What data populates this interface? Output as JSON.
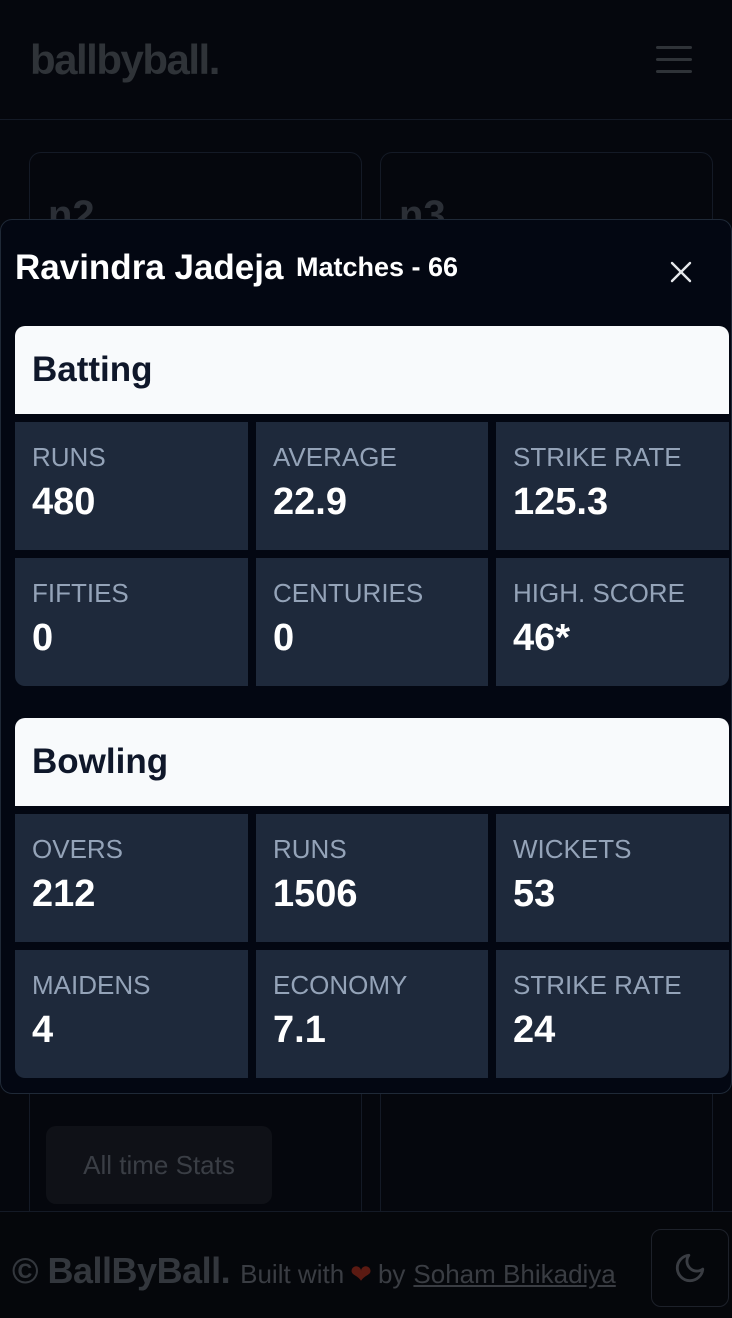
{
  "app": {
    "logo": "ballbyball."
  },
  "background": {
    "card_left_name": "n2",
    "card_right_name": "n3",
    "all_time_button": "All time Stats"
  },
  "footer": {
    "brand": "© BallByBall.",
    "built_with": "Built with",
    "heart": "❤",
    "by": "by",
    "author": "Soham Bhikadiya"
  },
  "modal": {
    "player_name": "Ravindra Jadeja",
    "matches": "Matches - 66",
    "batting": {
      "title": "Batting",
      "stats": [
        {
          "label": "RUNS",
          "value": "480"
        },
        {
          "label": "AVERAGE",
          "value": "22.9"
        },
        {
          "label": "STRIKE RATE",
          "value": "125.3"
        },
        {
          "label": "FIFTIES",
          "value": "0"
        },
        {
          "label": "CENTURIES",
          "value": "0"
        },
        {
          "label": "HIGH. SCORE",
          "value": "46*"
        }
      ]
    },
    "bowling": {
      "title": "Bowling",
      "stats": [
        {
          "label": "OVERS",
          "value": "212"
        },
        {
          "label": "RUNS",
          "value": "1506"
        },
        {
          "label": "WICKETS",
          "value": "53"
        },
        {
          "label": "MAIDENS",
          "value": "4"
        },
        {
          "label": "ECONOMY",
          "value": "7.1"
        },
        {
          "label": "STRIKE RATE",
          "value": "24"
        }
      ]
    }
  },
  "colors": {
    "modal_bg": "#030712",
    "cell_bg": "#1e293b",
    "section_head_bg": "#f8fafc",
    "label": "#94a3b8"
  },
  "icons": [
    "hamburger-menu-icon",
    "close-icon",
    "moon-icon",
    "heart-icon"
  ]
}
